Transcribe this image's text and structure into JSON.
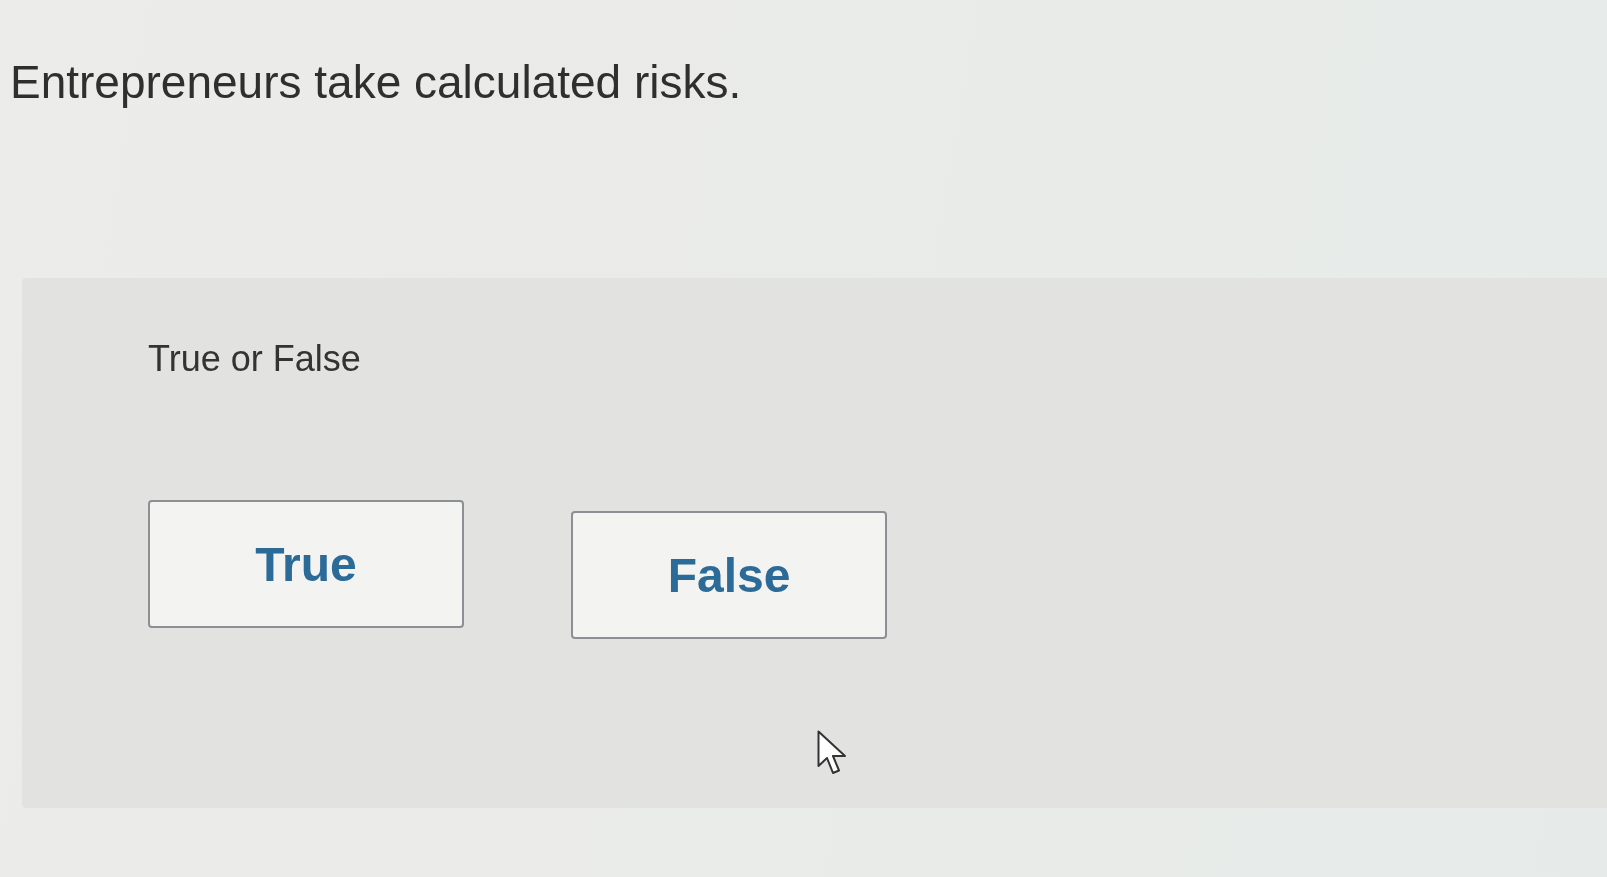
{
  "question": {
    "text": "Entrepreneurs take calculated risks."
  },
  "answer_panel": {
    "label": "True or False",
    "options": [
      {
        "label": "True",
        "selected": false
      },
      {
        "label": "False",
        "selected": false
      }
    ]
  }
}
